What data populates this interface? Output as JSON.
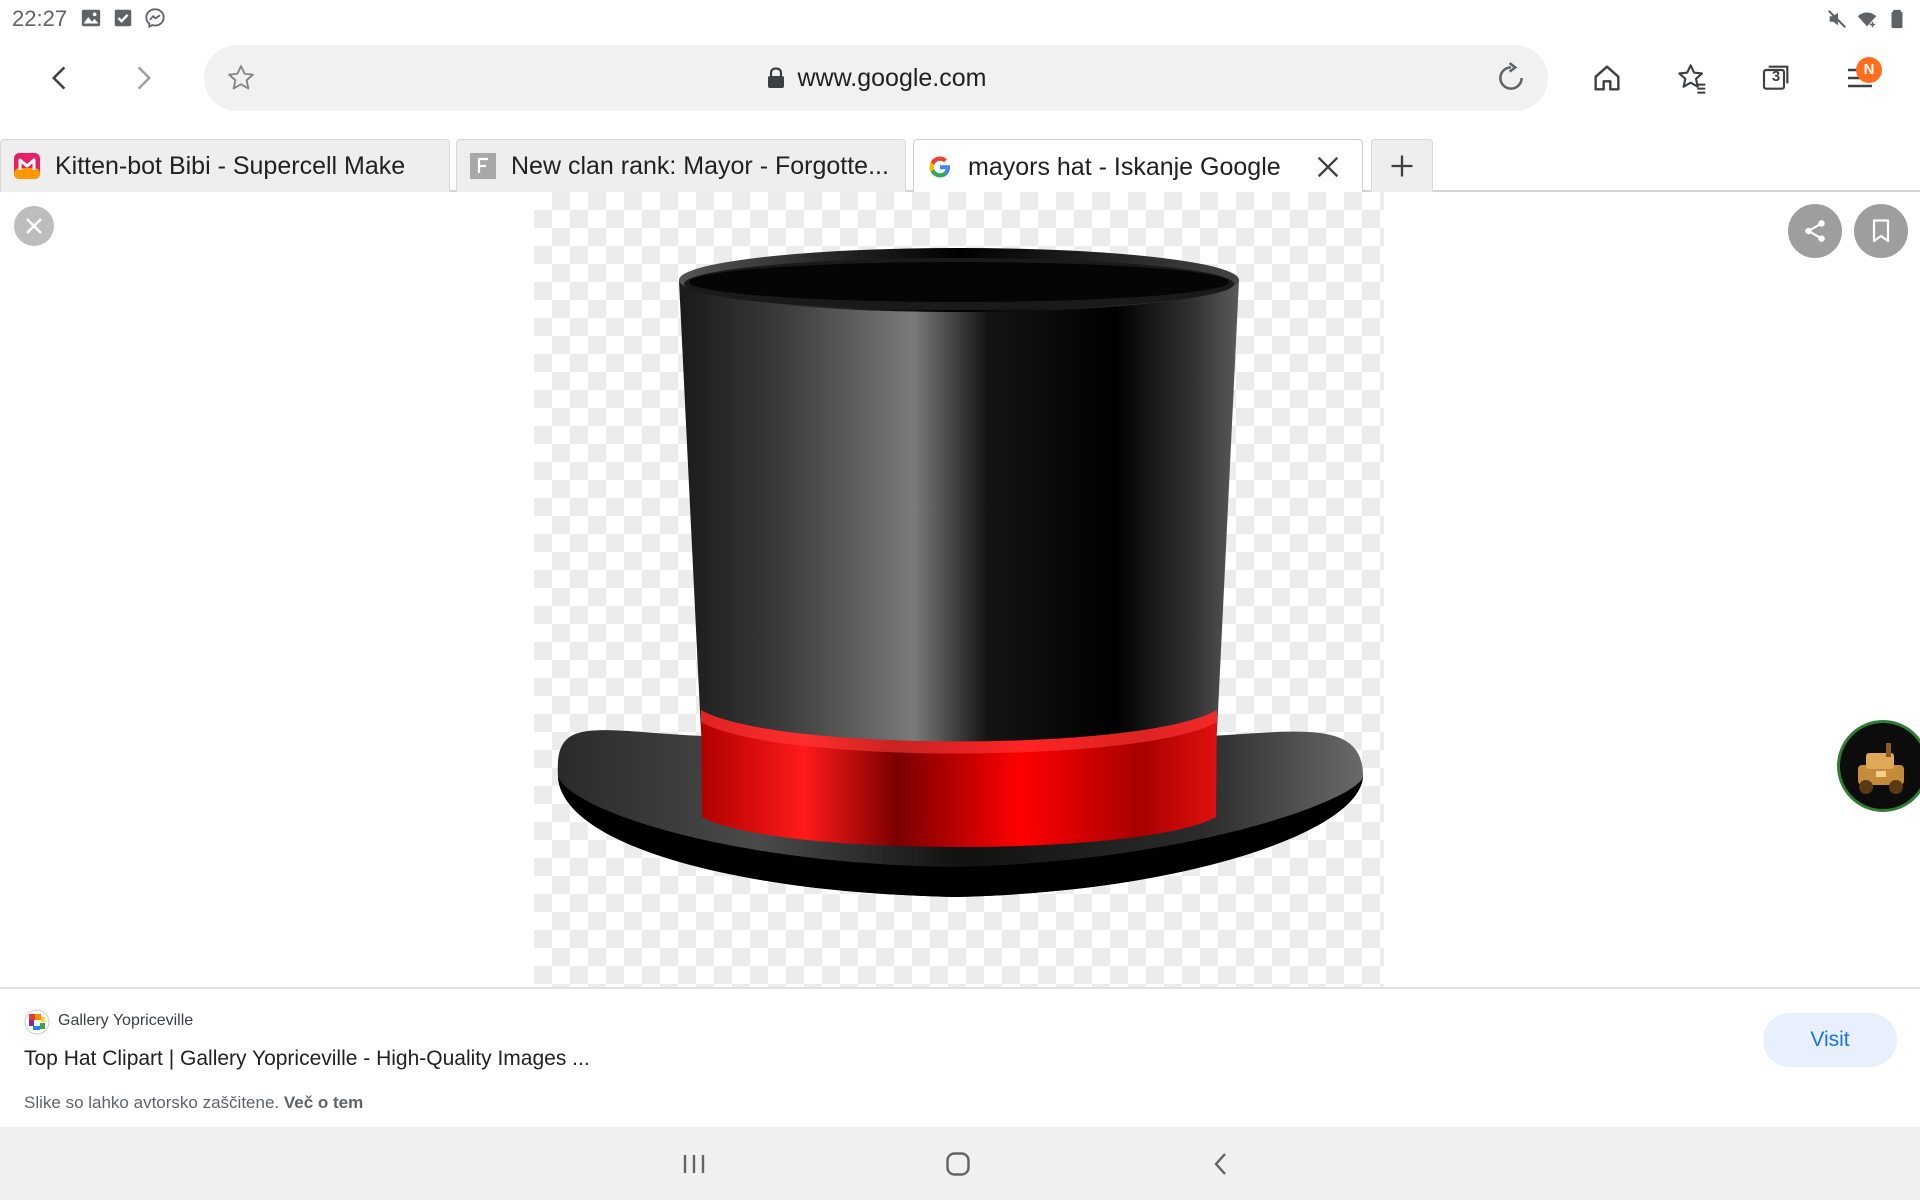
{
  "status_bar": {
    "time": "22:27",
    "left_icons": [
      "gallery-icon",
      "checkbox-notification-icon",
      "messenger-icon"
    ],
    "right_icons": [
      "mute-icon",
      "wifi-icon",
      "battery-icon"
    ]
  },
  "toolbar": {
    "url": "www.google.com",
    "tab_count": "3",
    "menu_badge": "N",
    "icons": [
      "back-arrow-icon",
      "forward-arrow-icon",
      "star-icon",
      "lock-icon",
      "reload-icon",
      "home-icon",
      "bookmarks-icon",
      "tabs-icon",
      "menu-icon"
    ]
  },
  "tabs": [
    {
      "title": "Kitten-bot Bibi - Supercell Make",
      "favicon": "supercell-make-favicon",
      "active": false
    },
    {
      "title": "New clan rank: Mayor - Forgotte...",
      "favicon": "forum-f-favicon",
      "active": false
    },
    {
      "title": "mayors hat - Iskanje Google",
      "favicon": "google-favicon",
      "active": true
    }
  ],
  "viewer": {
    "icons": [
      "close-icon",
      "share-icon",
      "bookmark-icon"
    ]
  },
  "result": {
    "source_name": "Gallery Yopriceville",
    "title": "Top Hat Clipart | Gallery Yopriceville - High-Quality Images ...",
    "copyright_text": "Slike so lahko avtorsko zaščitene.",
    "learn_more": "Več o tem",
    "visit_label": "Visit"
  },
  "colors": {
    "accent_blue": "#1a73e8",
    "badge_orange": "#ff6d1f",
    "hat_band_red": "#e00000"
  }
}
